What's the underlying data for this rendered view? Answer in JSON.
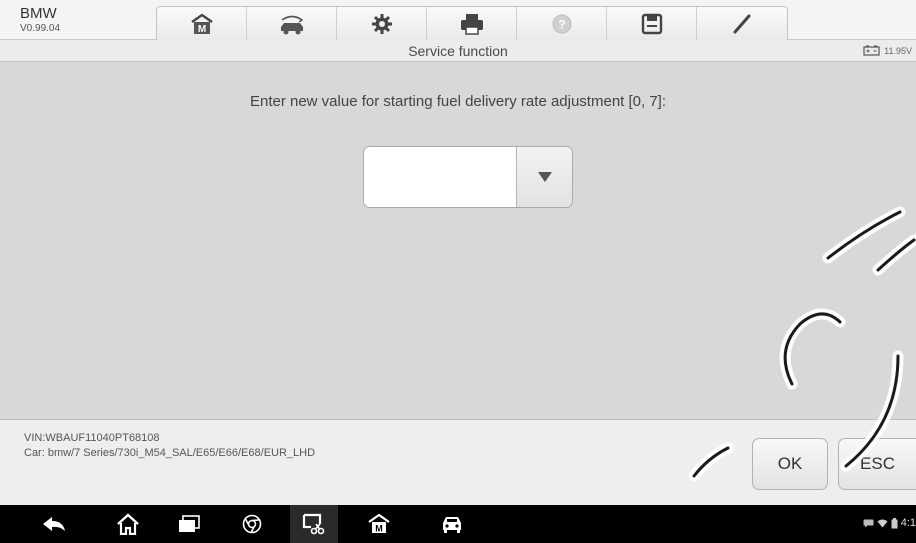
{
  "header": {
    "make": "BMW",
    "version": "V0.99.04",
    "toolbar": [
      {
        "name": "home-icon"
      },
      {
        "name": "vehicle-swap-icon"
      },
      {
        "name": "settings-icon"
      },
      {
        "name": "print-icon"
      },
      {
        "name": "help-icon"
      },
      {
        "name": "save-icon"
      },
      {
        "name": "data-logging-icon"
      }
    ]
  },
  "titlebar": {
    "title": "Service function",
    "battery_voltage": "11.95V"
  },
  "main": {
    "prompt": "Enter new value for starting fuel delivery rate adjustment [0, 7]:",
    "input_value": ""
  },
  "info": {
    "vin": "VIN:WBAUF11040PT68108",
    "car": "Car: bmw/7 Series/730i_M54_SAL/E65/E66/E68/EUR_LHD"
  },
  "buttons": {
    "ok": "OK",
    "esc": "ESC"
  },
  "navbar": {
    "icons": [
      "back-icon",
      "home-icon",
      "recent-apps-icon",
      "chrome-icon",
      "screenshot-icon",
      "maxisys-home-icon",
      "vehicle-icon"
    ],
    "clock": "4:1"
  }
}
